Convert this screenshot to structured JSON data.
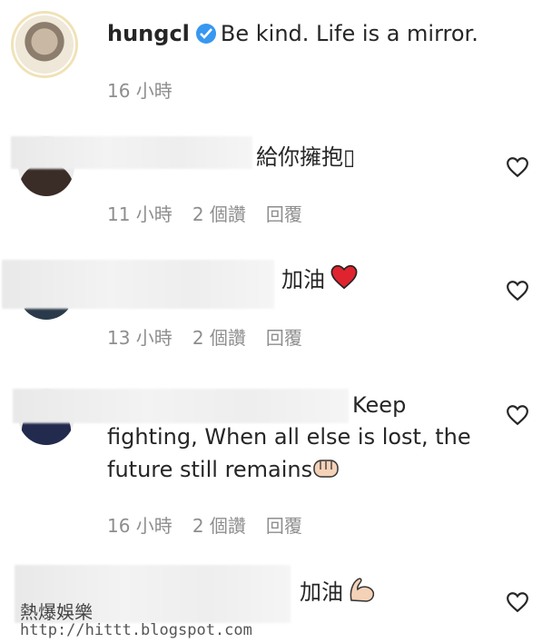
{
  "caption": {
    "username": "hungcl",
    "text": "Be kind. Life is a mirror.",
    "time": "16 小時"
  },
  "comments": [
    {
      "text": "給你擁抱",
      "trailing_glyph": "▯",
      "time": "11 小時",
      "likes": "2 個讚",
      "reply": "回覆"
    },
    {
      "text": "加油",
      "emoji": "red-heart",
      "time": "13 小時",
      "likes": "2 個讚",
      "reply": "回覆"
    },
    {
      "text_line1": "Keep",
      "text_line2": "fighting, When all else is lost, the",
      "text_line3": "future still remains",
      "emoji": "fist",
      "time": "16 小時",
      "likes": "2 個讚",
      "reply": "回覆"
    },
    {
      "text": "加油",
      "emoji": "flexed-biceps"
    }
  ],
  "watermark": {
    "line1": "熱爆娛樂",
    "line2": "http://hittt.blogspot.com"
  },
  "colors": {
    "verified": "#3897f0",
    "muted": "#8e8e8e",
    "heart_red": "#e0242f"
  }
}
